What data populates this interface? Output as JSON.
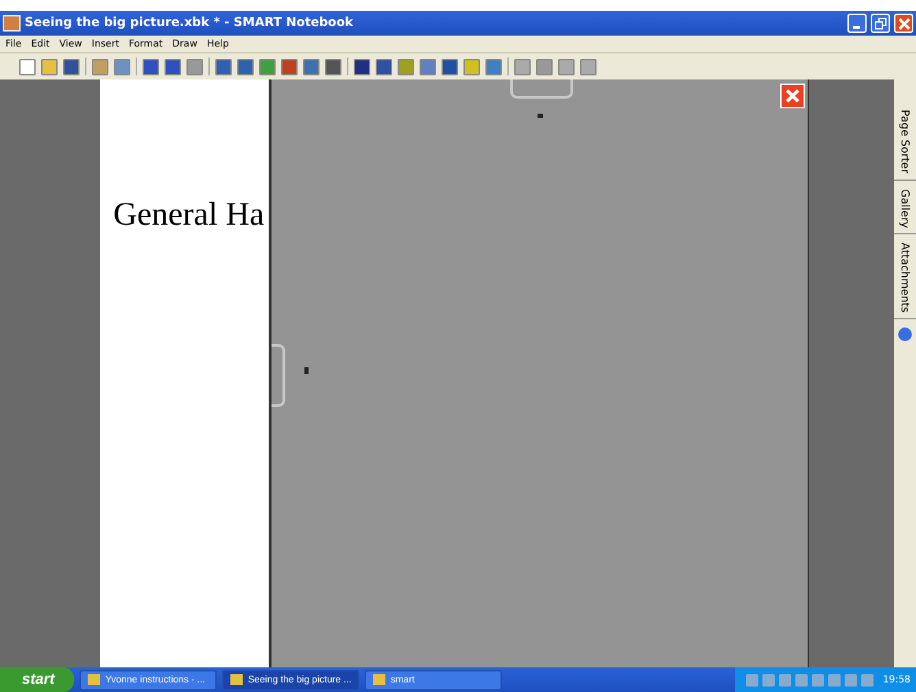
{
  "window": {
    "title": "Seeing the big picture.xbk * - SMART Notebook"
  },
  "menu": [
    "File",
    "Edit",
    "View",
    "Insert",
    "Format",
    "Draw",
    "Help"
  ],
  "page": {
    "text": "General Ha"
  },
  "side_tabs": [
    {
      "label": "Page Sorter",
      "selected": false
    },
    {
      "label": "Gallery",
      "selected": false
    },
    {
      "label": "Attachments",
      "selected": false
    }
  ],
  "taskbar": {
    "start": "start",
    "tasks": [
      {
        "label": "Yvonne instructions - ...",
        "selected": false
      },
      {
        "label": "Seeing the big picture ...",
        "selected": true
      },
      {
        "label": "smart",
        "selected": false
      }
    ],
    "clock": "19:58"
  }
}
